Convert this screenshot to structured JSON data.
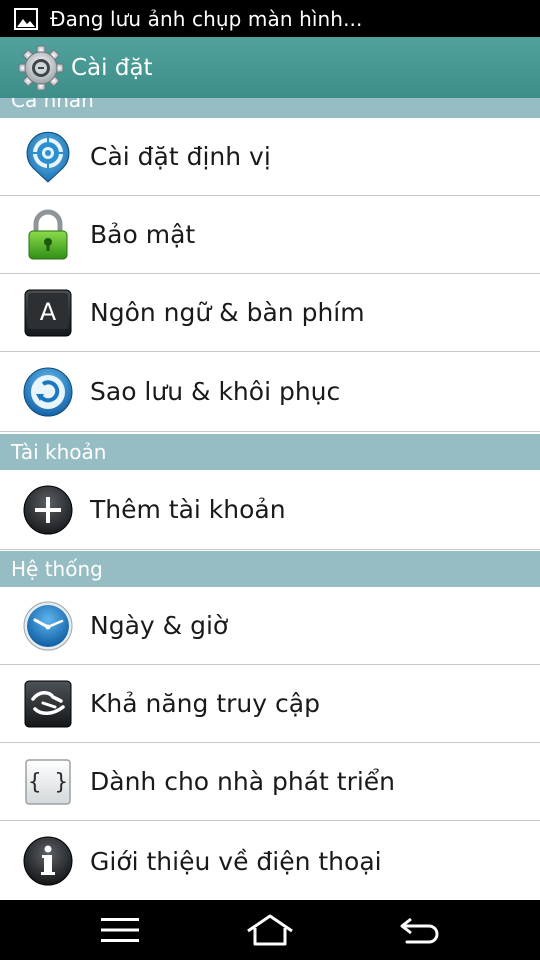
{
  "status_bar": {
    "notification_text": "Đang lưu ảnh chụp màn hình..."
  },
  "action_bar": {
    "title": "Cài đặt",
    "icon": "settings-gear-icon"
  },
  "sections": {
    "personal": {
      "header": "Cá nhân",
      "items": [
        {
          "label": "Cài đặt định vị",
          "icon": "location-icon"
        },
        {
          "label": "Bảo mật",
          "icon": "lock-icon"
        },
        {
          "label": "Ngôn ngữ & bàn phím",
          "icon": "keyboard-a-icon"
        },
        {
          "label": "Sao lưu & khôi phục",
          "icon": "backup-restore-icon"
        }
      ]
    },
    "accounts": {
      "header": "Tài khoản",
      "items": [
        {
          "label": "Thêm tài khoản",
          "icon": "add-icon"
        }
      ]
    },
    "system": {
      "header": "Hệ thống",
      "items": [
        {
          "label": "Ngày & giờ",
          "icon": "clock-icon"
        },
        {
          "label": "Khả năng truy cập",
          "icon": "accessibility-hand-icon"
        },
        {
          "label": "Dành cho nhà phát triển",
          "icon": "developer-braces-icon"
        },
        {
          "label": "Giới thiệu về điện thoại",
          "icon": "info-icon"
        }
      ]
    }
  },
  "nav_bar": {
    "buttons": [
      "menu-icon",
      "home-icon",
      "back-icon"
    ]
  },
  "colors": {
    "action_bar": "#3d8e8a",
    "section_header": "#96bcc4",
    "status_bar": "#000000"
  }
}
